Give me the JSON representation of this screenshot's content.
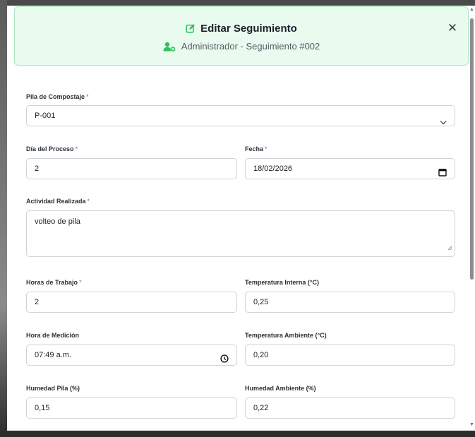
{
  "header": {
    "title": "Editar Seguimiento",
    "subtitle": "Administrador - Seguimiento #002",
    "close_label": "✕"
  },
  "colors": {
    "accent": "#2fbf5f",
    "header_bg": "#e9fbef",
    "header_border": "#a9e9bd"
  },
  "fields": {
    "pila": {
      "label": "Pila de Compostaje",
      "required": "*",
      "value": "P-001"
    },
    "dia": {
      "label": "Día del Proceso",
      "required": "*",
      "value": "2"
    },
    "fecha": {
      "label": "Fecha",
      "required": "*",
      "value": "18/02/2026"
    },
    "actividad": {
      "label": "Actividad Realizada",
      "required": "*",
      "value": "volteo de pila"
    },
    "horas": {
      "label": "Horas de Trabajo",
      "required": "*",
      "value": "2"
    },
    "temp_interna": {
      "label": "Temperatura Interna (°C)",
      "value": "0,25"
    },
    "hora_medicion": {
      "label": "Hora de Medición",
      "value": "07:49 a.m."
    },
    "temp_ambiente": {
      "label": "Temperatura Ambiente (°C)",
      "value": "0,20"
    },
    "humedad_pila": {
      "label": "Humedad Pila (%)",
      "value": "0,15"
    },
    "humedad_ambiente": {
      "label": "Humedad Ambiente (%)",
      "value": "0,22"
    }
  },
  "icons": {
    "edit": "edit-icon",
    "user": "user-gear-icon",
    "chevron": "chevron-down-icon",
    "calendar": "calendar-icon",
    "clock": "clock-icon"
  }
}
